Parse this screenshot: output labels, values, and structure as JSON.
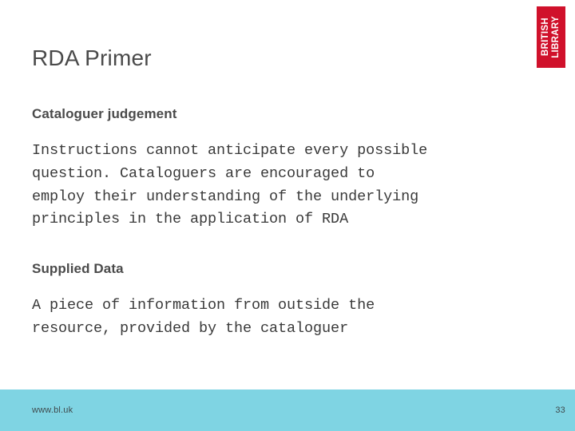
{
  "slide": {
    "title": "RDA Primer",
    "background_color": "#ffffff",
    "title_color": "#4a4a4a"
  },
  "logo": {
    "name": "british-library-logo",
    "line1": "BRITISH",
    "line2": "LIBRARY",
    "background_color": "#D0112B",
    "text_color": "#ffffff"
  },
  "content": {
    "sections": [
      {
        "heading": "Cataloguer judgement",
        "body": "Instructions cannot anticipate every possible\nquestion. Cataloguers are encouraged to\nemploy their understanding of the underlying\nprinciples in the application of RDA"
      },
      {
        "heading": "Supplied Data",
        "body": "A piece of information from outside the\nresource, provided by the cataloguer"
      }
    ]
  },
  "footer": {
    "url": "www.bl.uk",
    "page_number": "33",
    "background_color": "#7FD4E3",
    "text_color": "#3f4a4d"
  }
}
